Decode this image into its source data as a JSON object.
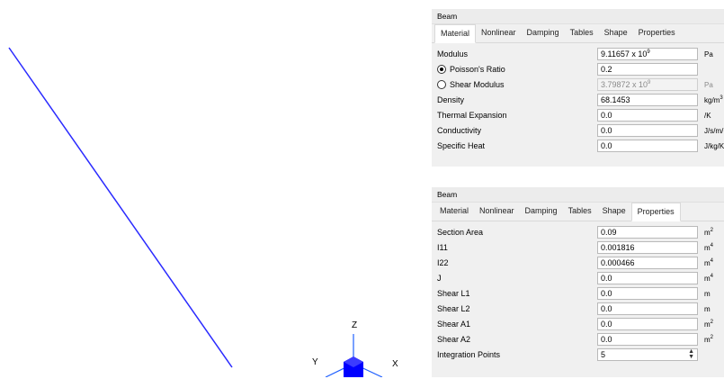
{
  "viewport": {
    "triad": {
      "z_label": "Z",
      "y_label": "Y",
      "x_label": "X"
    },
    "colors": {
      "beam_line": "#2a2aff",
      "triad_cube": "#0000ff",
      "triad_axes": "#2060ff"
    }
  },
  "material_panel": {
    "title": "Beam",
    "tabs": [
      "Material",
      "Nonlinear",
      "Damping",
      "Tables",
      "Shape",
      "Properties"
    ],
    "active_tab": "Material",
    "rows": [
      {
        "label": "Modulus",
        "value": "9.11657 x 10",
        "exp": "9",
        "unit": "Pa",
        "unit_exp": ""
      },
      {
        "label": "Poisson's Ratio",
        "value": "0.2",
        "exp": "",
        "unit": "",
        "unit_exp": "",
        "radio": "checked"
      },
      {
        "label": "Shear Modulus",
        "value": "3.79872 x 10",
        "exp": "9",
        "unit": "Pa",
        "unit_exp": "",
        "radio": "unchecked",
        "disabled": true
      },
      {
        "label": "Density",
        "value": "68.1453",
        "exp": "",
        "unit": "kg/m",
        "unit_exp": "3"
      },
      {
        "label": "Thermal Expansion",
        "value": "0.0",
        "exp": "",
        "unit": "/K",
        "unit_exp": ""
      },
      {
        "label": "Conductivity",
        "value": "0.0",
        "exp": "",
        "unit": "J/s/m/K",
        "unit_exp": ""
      },
      {
        "label": "Specific Heat",
        "value": "0.0",
        "exp": "",
        "unit": "J/kg/K",
        "unit_exp": ""
      }
    ]
  },
  "properties_panel": {
    "title": "Beam",
    "tabs": [
      "Material",
      "Nonlinear",
      "Damping",
      "Tables",
      "Shape",
      "Properties"
    ],
    "active_tab": "Properties",
    "rows": [
      {
        "label": "Section Area",
        "value": "0.09",
        "unit": "m",
        "unit_exp": "2"
      },
      {
        "label": "I11",
        "value": "0.001816",
        "unit": "m",
        "unit_exp": "4"
      },
      {
        "label": "I22",
        "value": "0.000466",
        "unit": "m",
        "unit_exp": "4"
      },
      {
        "label": "J",
        "value": "0.0",
        "unit": "m",
        "unit_exp": "4"
      },
      {
        "label": "Shear L1",
        "value": "0.0",
        "unit": "m",
        "unit_exp": ""
      },
      {
        "label": "Shear L2",
        "value": "0.0",
        "unit": "m",
        "unit_exp": ""
      },
      {
        "label": "Shear A1",
        "value": "0.0",
        "unit": "m",
        "unit_exp": "2"
      },
      {
        "label": "Shear A2",
        "value": "0.0",
        "unit": "m",
        "unit_exp": "2"
      },
      {
        "label": "Integration Points",
        "value": "5",
        "unit": "",
        "unit_exp": "",
        "spinner": true
      }
    ]
  }
}
